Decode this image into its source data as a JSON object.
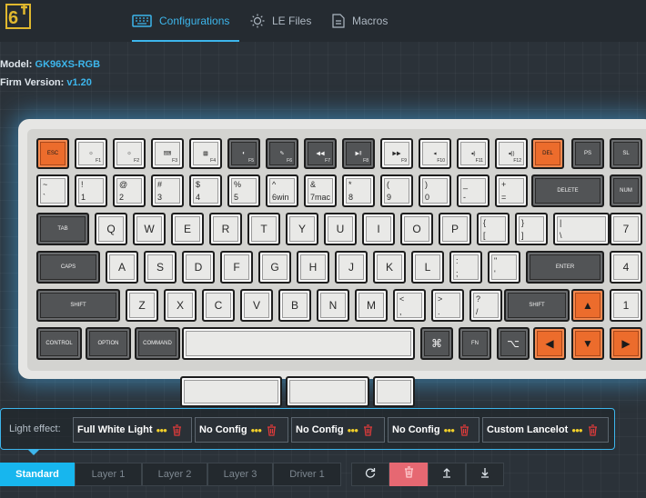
{
  "nav": {
    "tabs": [
      {
        "label": "Configurations",
        "active": true,
        "icon": "keyboard-icon"
      },
      {
        "label": "LE Files",
        "active": false,
        "icon": "sun-icon"
      },
      {
        "label": "Macros",
        "active": false,
        "icon": "document-icon"
      }
    ]
  },
  "device": {
    "model_label": "Model:",
    "model_value": "GK96XS-RGB",
    "firm_label": "Firm Version:",
    "firm_value": "v1.20"
  },
  "light_effect": {
    "label": "Light effect:",
    "slots": [
      {
        "name": "Full White Light"
      },
      {
        "name": "No Config"
      },
      {
        "name": "No Config"
      },
      {
        "name": "No Config"
      },
      {
        "name": "Custom Lancelot"
      }
    ]
  },
  "layers": [
    "Standard",
    "Layer 1",
    "Layer 2",
    "Layer 3",
    "Driver 1"
  ],
  "active_layer": "Standard",
  "actions": [
    {
      "icon": "refresh-icon"
    },
    {
      "icon": "trash-icon"
    },
    {
      "icon": "upload-icon"
    },
    {
      "icon": "download-icon"
    }
  ],
  "colors": {
    "accent": "#3db6ec",
    "orange_key": "#ec6c2c",
    "dark_key": "#525456",
    "light_key": "#e9e9e7"
  },
  "keyboard": {
    "r0": [
      {
        "m": "ESC",
        "s": "orange"
      },
      {
        "m": "☼",
        "b": "F1"
      },
      {
        "m": "☼",
        "b": "F2"
      },
      {
        "m": "⌨",
        "b": "F3"
      },
      {
        "m": "▦",
        "b": "F4"
      },
      {
        "m": "◐",
        "b": "F5",
        "s": "dark"
      },
      {
        "m": "✎",
        "b": "F6",
        "s": "dark"
      },
      {
        "m": "◀◀",
        "b": "F7",
        "s": "dark"
      },
      {
        "m": "▶‖",
        "b": "F8",
        "s": "dark"
      },
      {
        "m": "▶▶",
        "b": "F9"
      },
      {
        "m": "◂",
        "b": "F10"
      },
      {
        "m": "◂)",
        "b": "F11"
      },
      {
        "m": "◂))",
        "b": "F12"
      },
      {
        "m": "DEL",
        "s": "orange"
      },
      {
        "m": "PS",
        "s": "dark"
      },
      {
        "m": "SL",
        "s": "dark"
      }
    ],
    "r1": [
      {
        "t": "~",
        "b": "`"
      },
      {
        "t": "!",
        "b": "1"
      },
      {
        "t": "@",
        "b": "2"
      },
      {
        "t": "#",
        "b": "3"
      },
      {
        "t": "$",
        "b": "4"
      },
      {
        "t": "%",
        "b": "5"
      },
      {
        "t": "^",
        "b": "6win"
      },
      {
        "t": "&",
        "b": "7mac"
      },
      {
        "t": "*",
        "b": "8"
      },
      {
        "t": "(",
        "b": "9"
      },
      {
        "t": ")",
        "b": "0"
      },
      {
        "t": "_",
        "b": "-"
      },
      {
        "t": "+",
        "b": "="
      },
      {
        "m": "DELETE",
        "s": "dark"
      },
      {
        "m": "NUM",
        "s": "dark"
      }
    ],
    "r2": [
      {
        "m": "TAB",
        "s": "dark"
      },
      {
        "m": "Q"
      },
      {
        "m": "W"
      },
      {
        "m": "E"
      },
      {
        "m": "R"
      },
      {
        "m": "T"
      },
      {
        "m": "Y"
      },
      {
        "m": "U"
      },
      {
        "m": "I"
      },
      {
        "m": "O"
      },
      {
        "m": "P"
      },
      {
        "t": "{",
        "b": "["
      },
      {
        "t": "}",
        "b": "]"
      },
      {
        "t": "|",
        "b": "\\"
      },
      {
        "m": "7"
      }
    ],
    "r3": [
      {
        "m": "CAPS",
        "s": "dark"
      },
      {
        "m": "A"
      },
      {
        "m": "S"
      },
      {
        "m": "D"
      },
      {
        "m": "F"
      },
      {
        "m": "G"
      },
      {
        "m": "H"
      },
      {
        "m": "J"
      },
      {
        "m": "K"
      },
      {
        "m": "L"
      },
      {
        "t": ":",
        "b": ";"
      },
      {
        "t": "\"",
        "b": "'"
      },
      {
        "m": "ENTER",
        "s": "dark"
      },
      {
        "m": "4"
      }
    ],
    "r4": [
      {
        "m": "SHIFT",
        "s": "dark"
      },
      {
        "m": "Z"
      },
      {
        "m": "X"
      },
      {
        "m": "C"
      },
      {
        "m": "V"
      },
      {
        "m": "B"
      },
      {
        "m": "N"
      },
      {
        "m": "M"
      },
      {
        "t": "<",
        "b": ","
      },
      {
        "t": ">",
        "b": "."
      },
      {
        "t": "?",
        "b": "/"
      },
      {
        "m": "SHIFT",
        "s": "dark"
      },
      {
        "m": "▲",
        "s": "orange"
      },
      {
        "m": "1"
      }
    ],
    "r5": [
      {
        "m": "CONTROL",
        "s": "dark"
      },
      {
        "m": "OPTION",
        "s": "dark"
      },
      {
        "m": "COMMAND",
        "s": "dark"
      },
      {
        "m": ""
      },
      {
        "m": "⌘",
        "s": "dark"
      },
      {
        "m": "FN",
        "s": "dark"
      },
      {
        "m": "⌥",
        "s": "dark"
      },
      {
        "m": "◀",
        "s": "orange"
      },
      {
        "m": "▼",
        "s": "orange"
      },
      {
        "m": "▶",
        "s": "orange"
      }
    ],
    "r6": [
      {
        "m": ""
      },
      {
        "m": ""
      },
      {
        "m": ""
      }
    ]
  }
}
